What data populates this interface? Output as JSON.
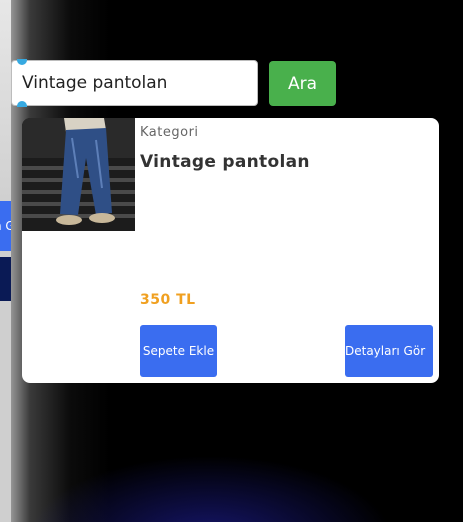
{
  "search": {
    "value": "Vintage pantolan",
    "button_label": "Ara"
  },
  "side_tab": {
    "label": "n G"
  },
  "product": {
    "category": "Kategori",
    "title": "Vintage pantolan",
    "price": "350 TL",
    "add_to_cart_label": "Sepete Ekle",
    "details_label": "Detayları Gör",
    "image_icon": "product-photo-jeans"
  },
  "colors": {
    "search_button": "#49b04c",
    "action_button": "#3a6df0",
    "price": "#f0a020"
  }
}
